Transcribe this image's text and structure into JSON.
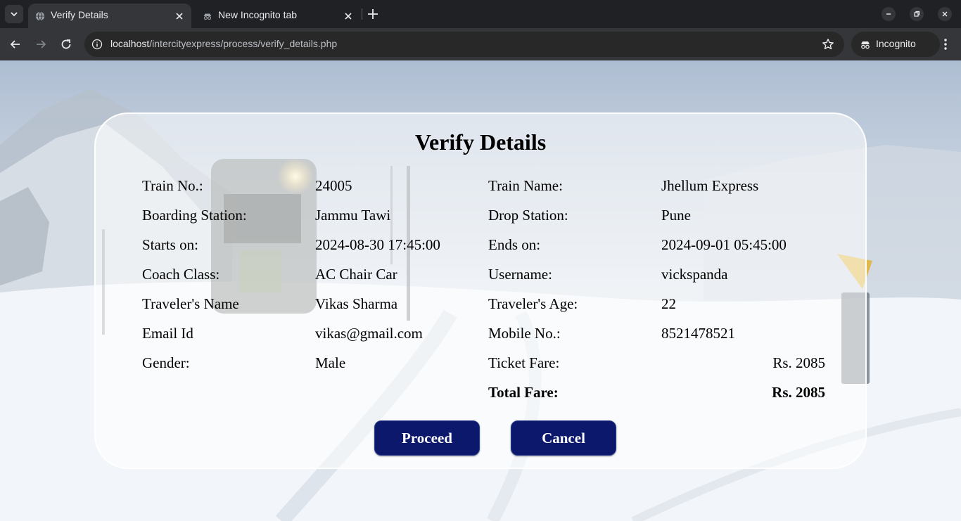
{
  "browser": {
    "tabs": [
      {
        "title": "Verify Details",
        "active": true
      },
      {
        "title": "New Incognito tab",
        "active": false
      }
    ],
    "url_host": "localhost",
    "url_path": "/intercityexpress/process/verify_details.php",
    "profile_label": "Incognito"
  },
  "page": {
    "title": "Verify Details",
    "fields": {
      "train_no": {
        "label": "Train No.:",
        "value": "24005"
      },
      "train_name": {
        "label": "Train Name:",
        "value": "Jhellum Express"
      },
      "boarding": {
        "label": "Boarding Station:",
        "value": "Jammu Tawi"
      },
      "drop": {
        "label": "Drop Station:",
        "value": "Pune"
      },
      "starts": {
        "label": "Starts on:",
        "value": "2024-08-30 17:45:00"
      },
      "ends": {
        "label": "Ends on:",
        "value": "2024-09-01 05:45:00"
      },
      "coach": {
        "label": "Coach Class:",
        "value": "AC Chair Car"
      },
      "username": {
        "label": "Username:",
        "value": "vickspanda"
      },
      "traveler_name": {
        "label": "Traveler's Name",
        "value": "Vikas Sharma"
      },
      "traveler_age": {
        "label": "Traveler's Age:",
        "value": "22"
      },
      "email": {
        "label": "Email Id",
        "value": "vikas@gmail.com"
      },
      "mobile": {
        "label": "Mobile No.:",
        "value": "8521478521"
      },
      "gender": {
        "label": "Gender:",
        "value": "Male"
      },
      "ticket_fare": {
        "label": "Ticket Fare:",
        "value": "Rs. 2085"
      },
      "total_fare": {
        "label": "Total Fare:",
        "value": "Rs. 2085"
      }
    },
    "buttons": {
      "proceed": "Proceed",
      "cancel": "Cancel"
    }
  },
  "colors": {
    "button_bg": "#0b186b",
    "browser_frame": "#202124",
    "browser_toolbar": "#35363a"
  }
}
